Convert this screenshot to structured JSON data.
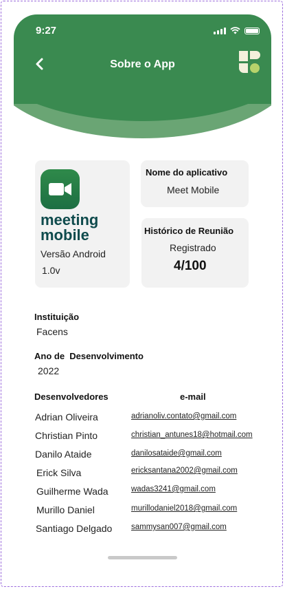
{
  "status_bar": {
    "time": "9:27"
  },
  "header": {
    "title": "Sobre o App"
  },
  "app_card": {
    "name_line1": "meeting",
    "name_line2": "mobile",
    "version_label": "Versão Android",
    "version_number": "1.0v"
  },
  "name_card": {
    "label": "Nome do aplicativo",
    "value": "Meet Mobile"
  },
  "history_card": {
    "label": "Histórico de Reunião",
    "status": "Registrado",
    "count": "4/100"
  },
  "institution": {
    "label": "Instituição",
    "value": "Facens"
  },
  "year": {
    "label": "Ano de  Desenvolvimento",
    "value": "2022"
  },
  "developers": {
    "header_name": "Desenvolvedores",
    "header_email": "e-mail",
    "rows": [
      {
        "name": "Adrian Oliveira",
        "email": "adrianoliv.contato@gmail.com"
      },
      {
        "name": "Christian Pinto",
        "email": "christian_antunes18@hotmail.com"
      },
      {
        "name": "Danilo Ataide",
        "email": "danilosataide@gmail.com"
      },
      {
        "name": "Erick Silva",
        "email": "ericksantana2002@gmail.com"
      },
      {
        "name": "Guilherme Wada",
        "email": "wadas3241@gmail.com"
      },
      {
        "name": "Murillo Daniel",
        "email": "murillodaniel2018@gmail.com"
      },
      {
        "name": "Santiago Delgado",
        "email": "sammysan007@gmail.com"
      }
    ]
  },
  "colors": {
    "header_green": "#3a8a50",
    "header_curve": "#6aa574",
    "app_name": "#0f4b4d",
    "card_bg": "#f2f2f2"
  }
}
